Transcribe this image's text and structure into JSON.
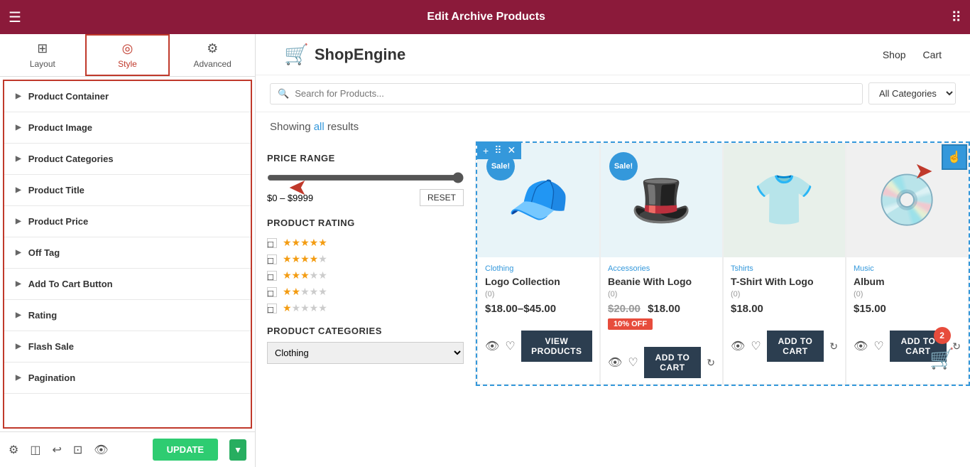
{
  "topbar": {
    "title": "Edit Archive Products",
    "hamburger": "☰",
    "grid": "⠿"
  },
  "sidebar": {
    "tabs": [
      {
        "label": "Layout",
        "icon": "⊞",
        "active": false
      },
      {
        "label": "Style",
        "icon": "◎",
        "active": true
      },
      {
        "label": "Advanced",
        "icon": "⚙",
        "active": false
      }
    ],
    "items": [
      {
        "label": "Product Container"
      },
      {
        "label": "Product Image"
      },
      {
        "label": "Product Categories"
      },
      {
        "label": "Product Title"
      },
      {
        "label": "Product Price"
      },
      {
        "label": "Off Tag"
      },
      {
        "label": "Add To Cart Button"
      },
      {
        "label": "Rating"
      },
      {
        "label": "Flash Sale"
      },
      {
        "label": "Pagination"
      }
    ]
  },
  "bottombar": {
    "update_label": "UPDATE"
  },
  "shopheader": {
    "logo_icon": "🛒",
    "logo_text": "ShopEngine",
    "nav": [
      "Shop",
      "Cart"
    ]
  },
  "search": {
    "placeholder": "Search for Products...",
    "category_default": "All Categories"
  },
  "results": {
    "text": "Showing all results",
    "highlight": "all"
  },
  "filter": {
    "price_range_title": "PRICE RANGE",
    "price_min": "$0",
    "price_max": "$9999",
    "reset_label": "RESET",
    "rating_title": "PRODUCT RATING",
    "ratings": [
      5,
      4,
      3,
      2,
      1
    ],
    "categories_title": "PRODUCT CATEGORIES",
    "category_option": "Clothing"
  },
  "products": [
    {
      "category": "Clothing",
      "name": "Logo Collection",
      "rating": "(0)",
      "price": "$18.00–$45.00",
      "has_sale": true,
      "has_off": false,
      "action": "VIEW PRODUCTS",
      "emoji": "🧢"
    },
    {
      "category": "Accessories",
      "name": "Beanie With Logo",
      "rating": "(0)",
      "price_old": "$20.00",
      "price_new": "$18.00",
      "off_text": "10% OFF",
      "has_sale": true,
      "has_off": true,
      "action": "ADD TO CART",
      "emoji": "🎩"
    },
    {
      "category": "Tshirts",
      "name": "T-Shirt With Logo",
      "rating": "(0)",
      "price": "$18.00",
      "has_sale": false,
      "has_off": false,
      "action": "ADD TO CART",
      "emoji": "👕"
    },
    {
      "category": "Music",
      "name": "Album",
      "rating": "(0)",
      "price": "$15.00",
      "has_sale": false,
      "has_off": false,
      "action": "ADD TO CART",
      "emoji": "💿"
    }
  ],
  "cart_badge": "2",
  "grid_controls": [
    "+",
    "⠿",
    "✕"
  ]
}
